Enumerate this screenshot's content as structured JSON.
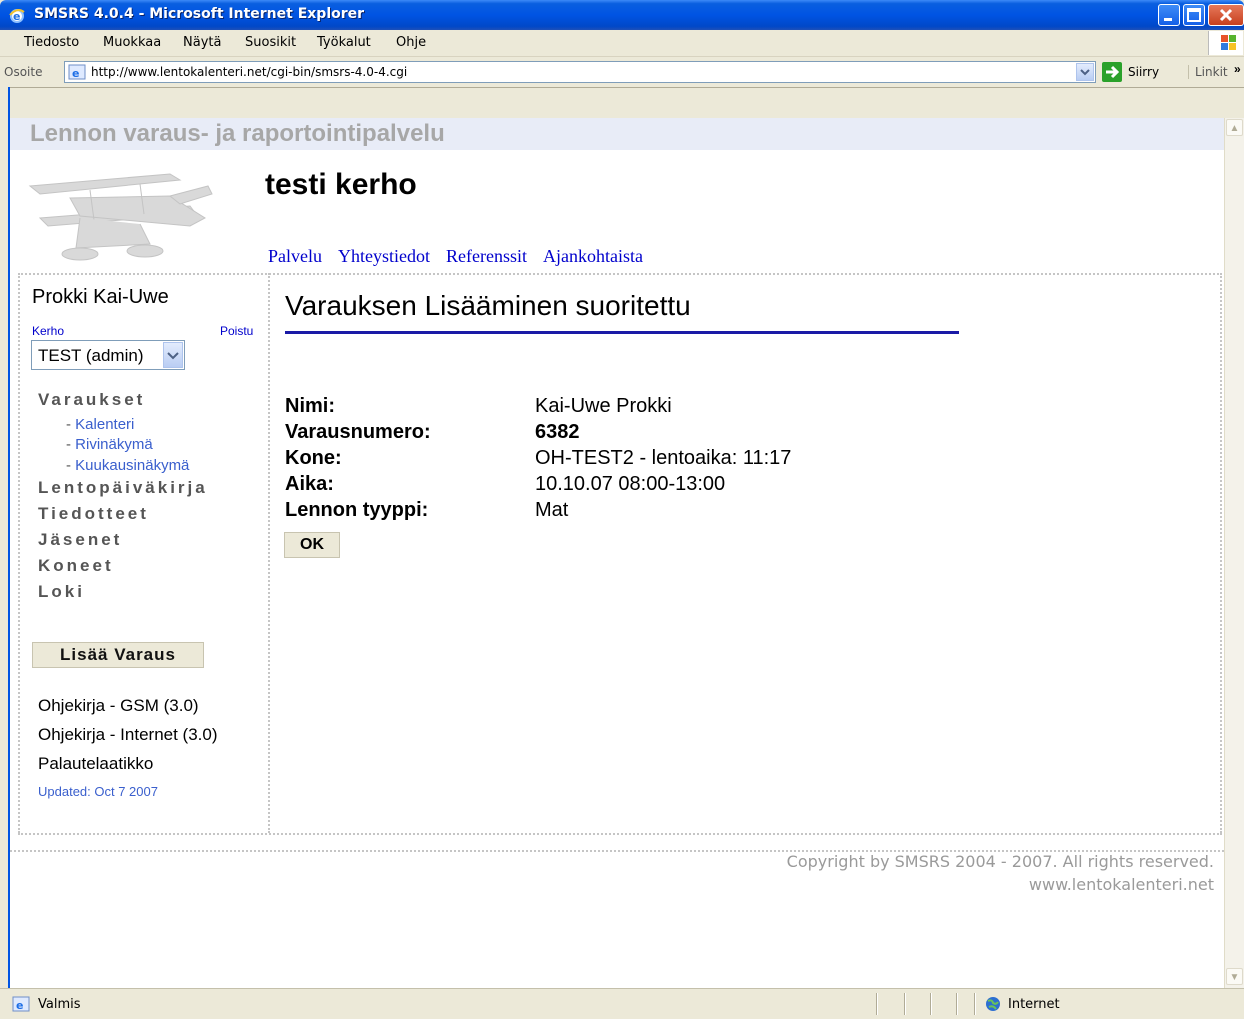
{
  "window": {
    "title": "SMSRS 4.0.4 - Microsoft Internet Explorer"
  },
  "menu": [
    "Tiedosto",
    "Muokkaa",
    "Näytä",
    "Suosikit",
    "Työkalut",
    "Ohje"
  ],
  "address_bar": {
    "label": "Osoite",
    "url": "http://www.lentokalenteri.net/cgi-bin/smsrs-4.0-4.cgi",
    "go_label": "Siirry",
    "links_label": "Linkit"
  },
  "page": {
    "service_title": "Lennon varaus- ja raportointipalvelu",
    "club_name": "testi kerho",
    "top_nav": [
      "Palvelu",
      "Yhteystiedot",
      "Referenssit",
      "Ajankohtaista"
    ],
    "sidebar": {
      "user_name": "Prokki Kai-Uwe",
      "club_label": "Kerho",
      "logout_label": "Poistu",
      "club_select_value": "TEST (admin)",
      "sections": {
        "reservations": "Varaukset",
        "sub": [
          "Kalenteri",
          "Rivinäkymä",
          "Kuukausinäkymä"
        ],
        "logbook": "Lentopäiväkirja",
        "bulletins": "Tiedotteet",
        "members": "Jäsenet",
        "aircraft": "Koneet",
        "log": "Loki"
      },
      "add_reservation_button": "Lisää Varaus",
      "links": [
        "Ohjekirja - GSM (3.0)",
        "Ohjekirja - Internet (3.0)",
        "Palautelaatikko"
      ],
      "updated": "Updated: Oct 7 2007"
    },
    "main": {
      "heading": "Varauksen Lisääminen suoritettu",
      "fields": [
        {
          "label": "Nimi:",
          "value": "Kai-Uwe Prokki"
        },
        {
          "label": "Varausnumero:",
          "value": "6382"
        },
        {
          "label": "Kone:",
          "value": "OH-TEST2 - lentoaika: 11:17"
        },
        {
          "label": "Aika:",
          "value": "10.10.07 08:00-13:00"
        },
        {
          "label": "Lennon tyyppi:",
          "value": "Mat"
        }
      ],
      "ok_button": "OK"
    },
    "footer": {
      "copyright": "Copyright by SMSRS 2004 - 2007. All rights reserved.",
      "site": "www.lentokalenteri.net"
    }
  },
  "status_bar": {
    "text": "Valmis",
    "zone": "Internet"
  }
}
